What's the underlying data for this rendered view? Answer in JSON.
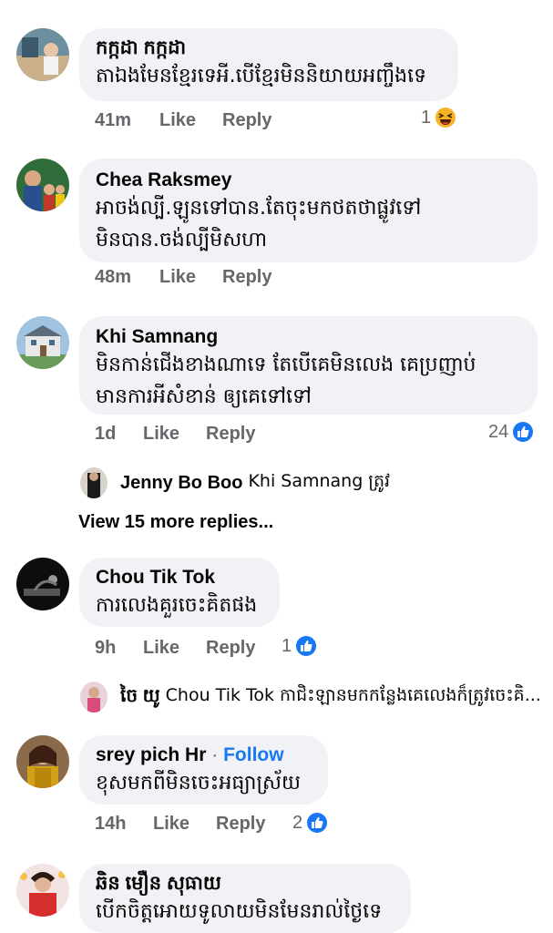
{
  "comments": [
    {
      "name": "កក្កដា កក្កដា",
      "text_lines": [
        "តាឯងមែនខ្មែរទេអី.បើខ្មែរមិននិយាយអញ្ចឹងទេ"
      ],
      "time": "41m",
      "like": "Like",
      "reply": "Reply",
      "reaction": {
        "count": "1",
        "icon": "haha-emoji-icon"
      }
    },
    {
      "name": "Chea Raksmey",
      "text_lines": [
        "អាចង់ល្បី.ឡូនទៅបាន.តែចុះមកថតថាផ្លូវទៅ",
        "មិនបាន.ចង់ល្បីមិសហា"
      ],
      "time": "48m",
      "like": "Like",
      "reply": "Reply"
    },
    {
      "name": "Khi Samnang",
      "text_lines": [
        "មិនកាន់ជើងខាងណាទេ  តែបើគេមិនលេង គេប្រញាប់",
        "មានការអីសំខាន់ ឲ្យគេទៅទៅ"
      ],
      "time": "1d",
      "like": "Like",
      "reply": "Reply",
      "reaction": {
        "count": "24",
        "icon": "like-thumb-icon"
      },
      "reply_preview": {
        "name": "Jenny Bo Boo",
        "text": "Khi Samnang ត្រូវ"
      },
      "view_more": "View 15 more replies..."
    },
    {
      "name": "Chou Tik Tok",
      "text_lines": [
        "ការលេងគួរចេះគិតផង"
      ],
      "time": "9h",
      "like": "Like",
      "reply": "Reply",
      "reaction": {
        "count": "1",
        "icon": "like-thumb-icon"
      },
      "reply_preview": {
        "name": "ចៃ យូ",
        "text": "Chou Tik Tok កាជិះឡានមកកន្លែងគេលេងក៏ត្រូវចេះគិ..."
      }
    },
    {
      "name": "srey pich Hr",
      "separator": "·",
      "follow": "Follow",
      "text_lines": [
        "ខុសមកពីមិនចេះអធ្យាស្រ័យ"
      ],
      "time": "14h",
      "like": "Like",
      "reply": "Reply",
      "reaction": {
        "count": "2",
        "icon": "like-thumb-icon"
      }
    },
    {
      "name": "ឆិន មឿន សុធាយ",
      "text_lines": [
        "បើកចិត្តអោយទូលាយមិនមែនរាល់ថ្ងៃទេ"
      ]
    }
  ],
  "colors": {
    "bubble": "#f0f2f5",
    "meta": "#65676b",
    "link": "#1877f2"
  }
}
